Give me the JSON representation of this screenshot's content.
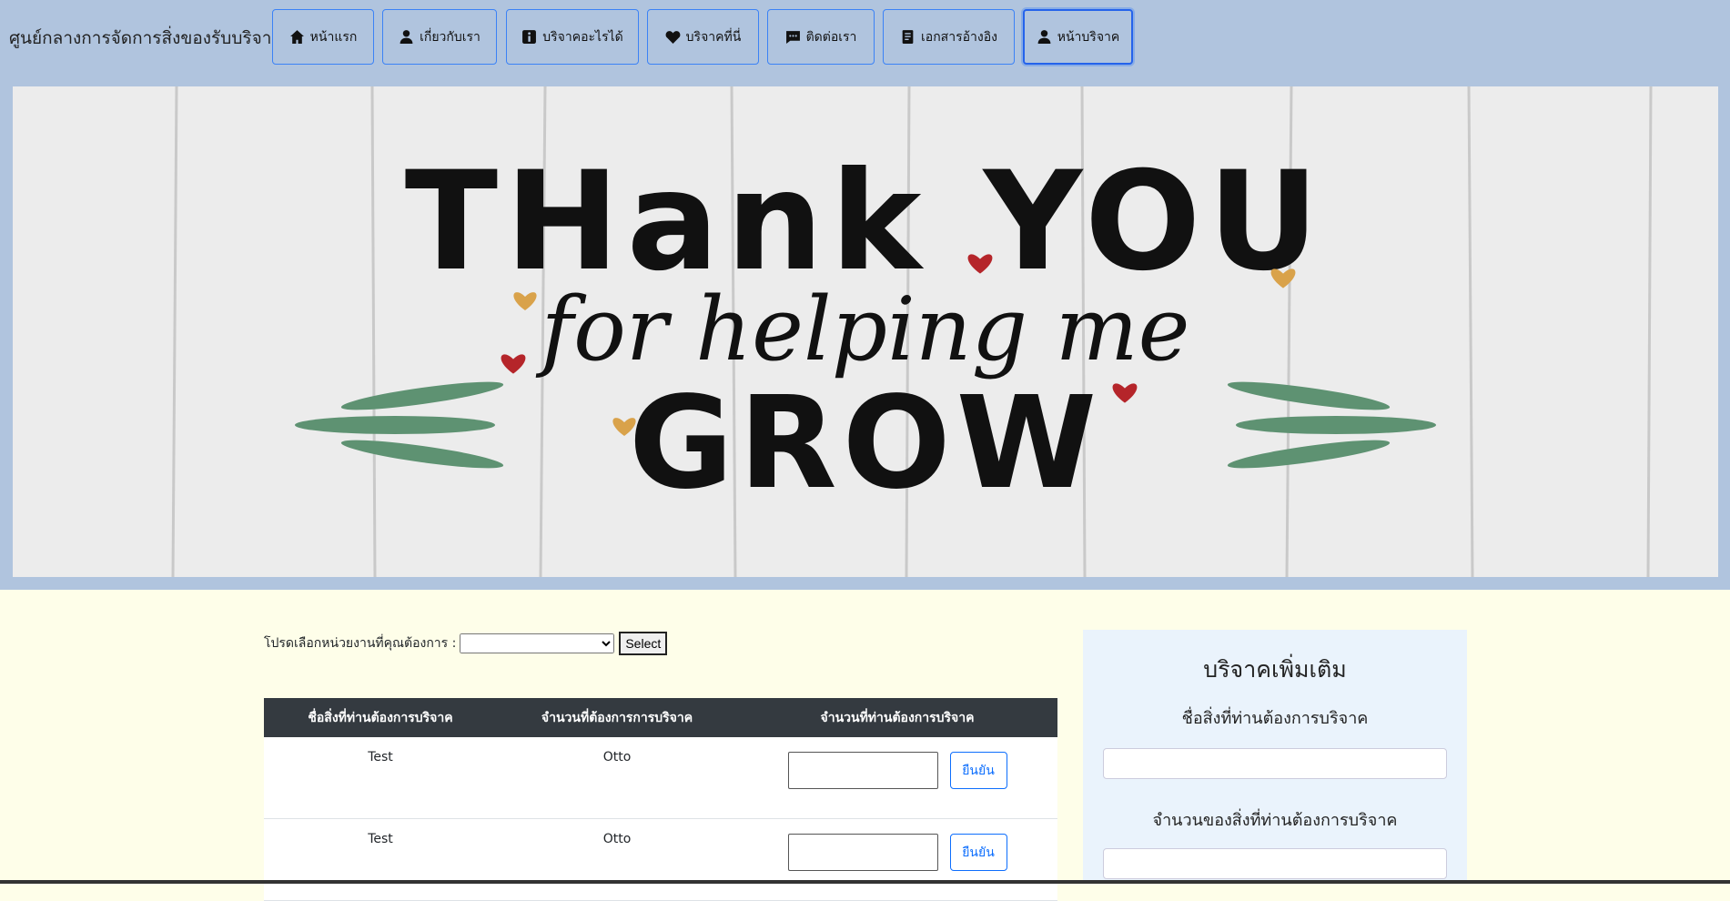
{
  "header": {
    "brand": "ศูนย์กลางการจัดการสิ่งของรับบริจาค",
    "nav": [
      {
        "label": "หน้าแรก",
        "icon": "home-icon"
      },
      {
        "label": "เกี่ยวกับเรา",
        "icon": "person-icon"
      },
      {
        "label": "บริจาคอะไรได้",
        "icon": "info-icon"
      },
      {
        "label": "บริจาคที่นี่",
        "icon": "heart-icon"
      },
      {
        "label": "ติดต่อเรา",
        "icon": "chat-icon"
      },
      {
        "label": "เอกสารอ้างอิง",
        "icon": "document-icon"
      },
      {
        "label": "หน้าบริจาค",
        "icon": "person-icon",
        "active": true
      }
    ]
  },
  "banner": {
    "line1": "THank YOU",
    "line2": "for helping me",
    "line3": "GROW"
  },
  "selector": {
    "label": "โปรดเลือกหน่วยงานที่คุณต้องการ :",
    "selected": "",
    "button": "Select"
  },
  "table": {
    "headers": [
      "ชื่อสิ่งที่ท่านต้องการบริจาค",
      "จำนวนที่ต้องการการบริจาค",
      "จำนวนที่ท่านต้องการบริจาค"
    ],
    "rows": [
      {
        "name": "Test",
        "amount": "Otto",
        "input_value": "",
        "button": "ยืนยัน"
      },
      {
        "name": "Test",
        "amount": "Otto",
        "input_value": "",
        "button": "ยืนยัน"
      }
    ]
  },
  "panel": {
    "title": "บริจาคเพิ่มเติม",
    "name_label": "ชื่อสิ่งที่ท่านต้องการบริจาค",
    "qty_label": "จำนวนของสิ่งที่ท่านต้องการบริจาค",
    "name_value": "",
    "qty_value": ""
  },
  "colors": {
    "header_bg": "#b0c4de",
    "page_bg": "#fefee9",
    "table_head": "#343a40",
    "accent": "#0d6efd",
    "panel_bg": "#eaf3fc",
    "heart_red": "#b5252a",
    "heart_gold": "#d9a24a",
    "leaf_green": "#5e9272"
  }
}
